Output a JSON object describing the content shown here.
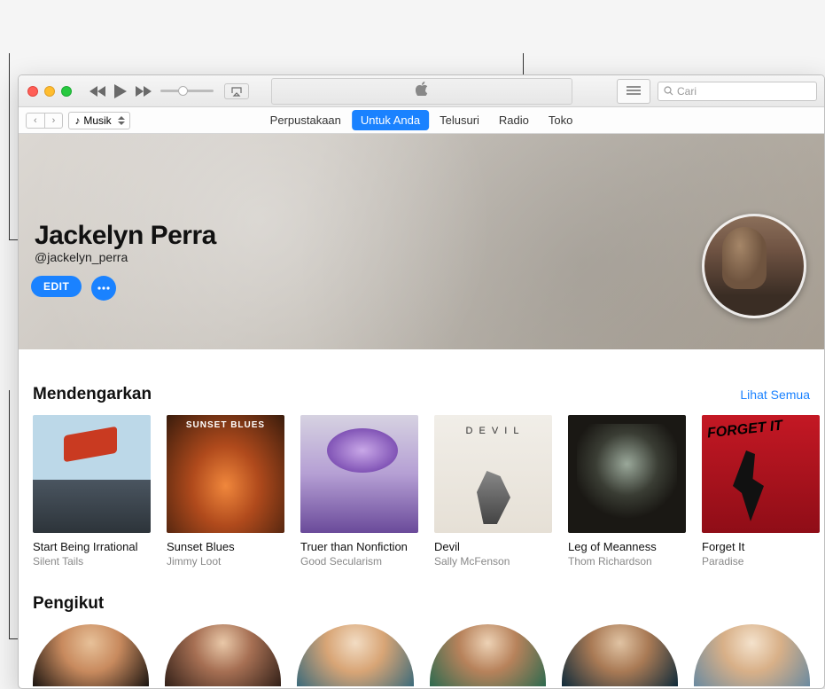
{
  "titlebar": {
    "search_placeholder": "Cari"
  },
  "navbar": {
    "library_selector": "Musik",
    "tabs": [
      "Perpustakaan",
      "Untuk Anda",
      "Telusuri",
      "Radio",
      "Toko"
    ],
    "active_tab_index": 1
  },
  "profile": {
    "name": "Jackelyn Perra",
    "handle": "@jackelyn_perra",
    "edit_label": "EDIT"
  },
  "listening": {
    "title": "Mendengarkan",
    "see_all": "Lihat Semua",
    "items": [
      {
        "title": "Start Being Irrational",
        "artist": "Silent Tails"
      },
      {
        "title": "Sunset Blues",
        "artist": "Jimmy Loot"
      },
      {
        "title": "Truer than Nonfiction",
        "artist": "Good Secularism"
      },
      {
        "title": "Devil",
        "artist": "Sally McFenson"
      },
      {
        "title": "Leg of Meanness",
        "artist": "Thom Richardson"
      },
      {
        "title": "Forget It",
        "artist": "Paradise"
      }
    ]
  },
  "followers": {
    "title": "Pengikut"
  }
}
